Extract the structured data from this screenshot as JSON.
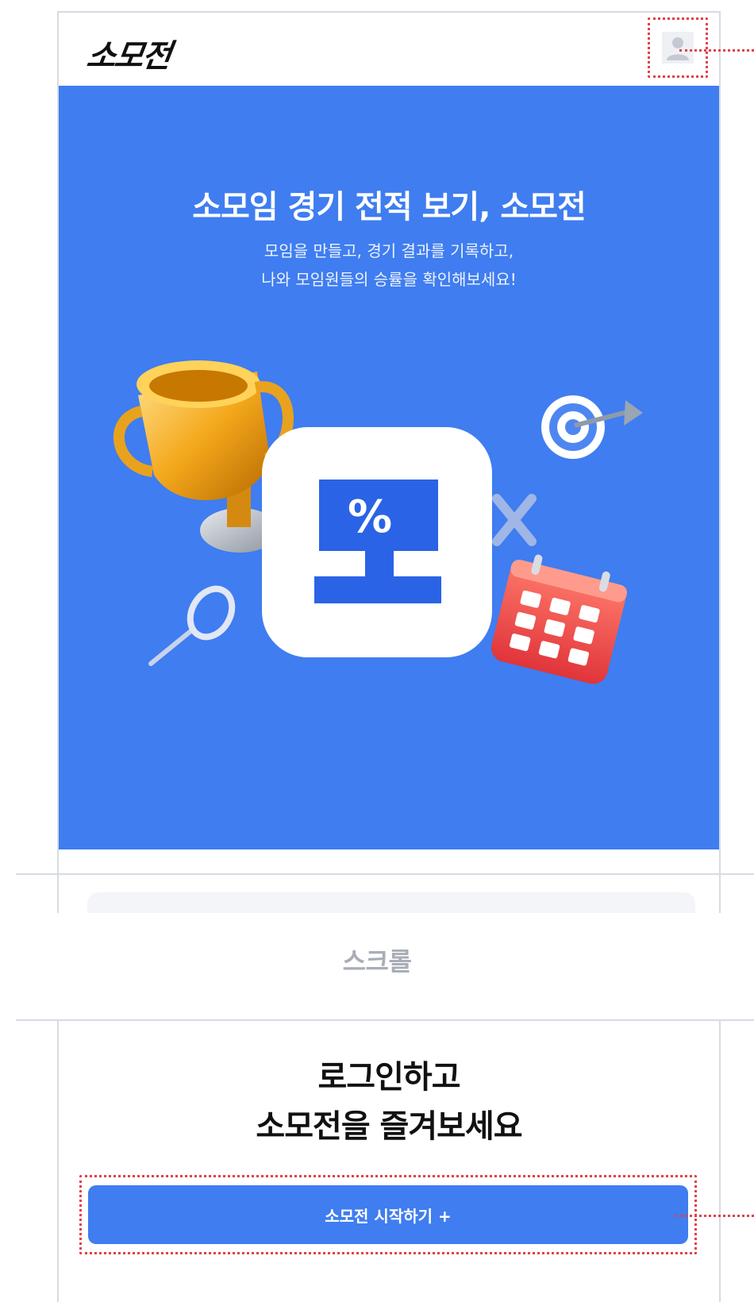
{
  "header": {
    "logo_text": "소모전",
    "profile_icon": "user-avatar-icon"
  },
  "hero": {
    "title": "소모임 경기 전적 보기, 소모전",
    "subtitle_line1": "모임을 만들고, 경기 결과를 기록하고,",
    "subtitle_line2": "나와 모임원들의 승률을 확인해보세요!",
    "app_icon_glyph": "%",
    "background_color": "#3f7df0",
    "decor_icons": [
      "trophy-icon",
      "target-icon",
      "calendar-icon",
      "magnifier-icon",
      "close-x-icon"
    ]
  },
  "scroll_label": "스크롤",
  "login": {
    "title_line1": "로그인하고",
    "title_line2": "소모전을 즐겨보세요",
    "start_button_label": "소모전 시작하기 +"
  },
  "colors": {
    "accent": "#3f7df0",
    "annotation": "#e0424a"
  }
}
